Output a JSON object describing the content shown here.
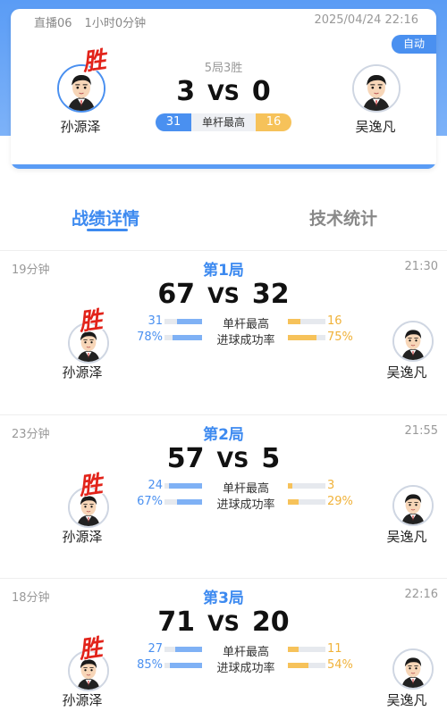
{
  "header": {
    "room": "直播06",
    "duration": "1小时0分钟",
    "datetime": "2025/04/24 22:16",
    "auto_label": "自动",
    "format": "5局3胜",
    "score_left": "3",
    "vs": "VS",
    "score_right": "0",
    "high_break_left": "31",
    "high_break_label": "单杆最高",
    "high_break_right": "16",
    "win_label": "胜",
    "player_left": "孙源泽",
    "player_right": "吴逸凡"
  },
  "tabs": [
    {
      "label": "战绩详情",
      "active": true
    },
    {
      "label": "技术统计",
      "active": false
    }
  ],
  "frames": [
    {
      "duration": "19分钟",
      "time": "21:30",
      "title": "第1局",
      "score_left": "67",
      "vs": "VS",
      "score_right": "32",
      "win_label": "胜",
      "player_left": "孙源泽",
      "player_right": "吴逸凡",
      "stats": [
        {
          "label": "单杆最高",
          "left": "31",
          "right": "16",
          "left_ratio": 0.66,
          "right_ratio": 0.34
        },
        {
          "label": "进球成功率",
          "left": "78%",
          "right": "75%",
          "left_ratio": 0.78,
          "right_ratio": 0.75
        }
      ]
    },
    {
      "duration": "23分钟",
      "time": "21:55",
      "title": "第2局",
      "score_left": "57",
      "vs": "VS",
      "score_right": "5",
      "win_label": "胜",
      "player_left": "孙源泽",
      "player_right": "吴逸凡",
      "stats": [
        {
          "label": "单杆最高",
          "left": "24",
          "right": "3",
          "left_ratio": 0.89,
          "right_ratio": 0.11
        },
        {
          "label": "进球成功率",
          "left": "67%",
          "right": "29%",
          "left_ratio": 0.67,
          "right_ratio": 0.29
        }
      ]
    },
    {
      "duration": "18分钟",
      "time": "22:16",
      "title": "第3局",
      "score_left": "71",
      "vs": "VS",
      "score_right": "20",
      "win_label": "胜",
      "player_left": "孙源泽",
      "player_right": "吴逸凡",
      "stats": [
        {
          "label": "单杆最高",
          "left": "27",
          "right": "11",
          "left_ratio": 0.71,
          "right_ratio": 0.29
        },
        {
          "label": "进球成功率",
          "left": "85%",
          "right": "54%",
          "left_ratio": 0.85,
          "right_ratio": 0.54
        }
      ]
    }
  ],
  "colors": {
    "accent_blue": "#4a90f0",
    "accent_orange": "#f6c25a",
    "win_red": "#e2231a"
  },
  "icons": {
    "avatar": "player-avatar-cartoon"
  }
}
